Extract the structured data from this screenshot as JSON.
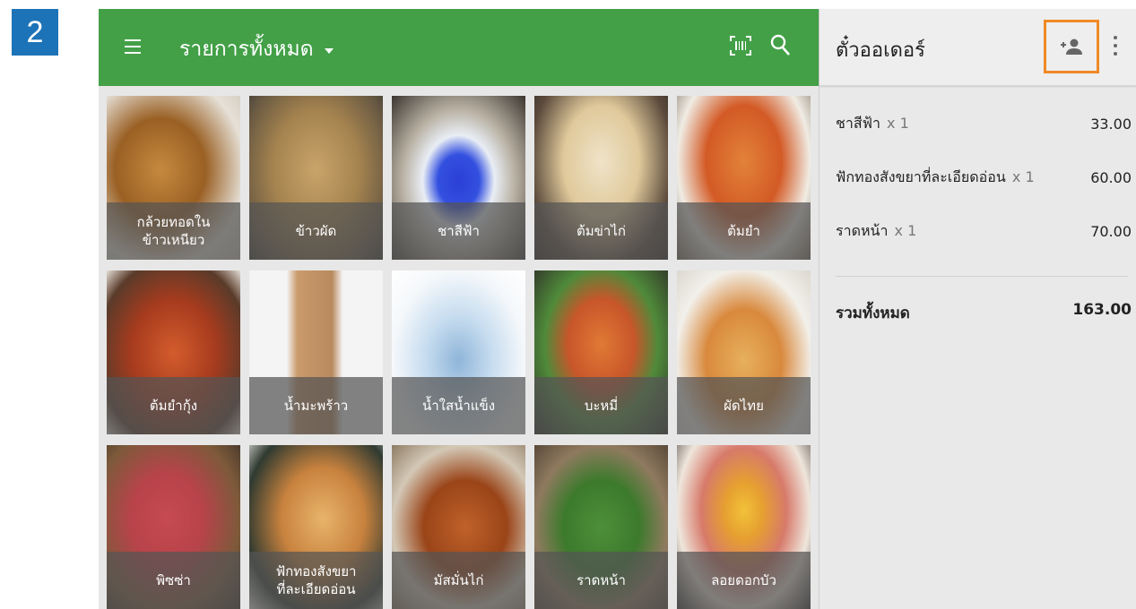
{
  "step": {
    "number": "2",
    "color": "#1d73b8"
  },
  "header": {
    "category_title": "รายการทั้งหมด",
    "accent": "#43a047",
    "icons": [
      "menu-icon",
      "barcode-icon",
      "search-icon"
    ]
  },
  "items": [
    {
      "name": "กล้วยทอดใน\nข้าวเหนียว"
    },
    {
      "name": "ข้าวผัด"
    },
    {
      "name": "ชาสีฟ้า"
    },
    {
      "name": "ต้มข่าไก่"
    },
    {
      "name": "ต้มยำ"
    },
    {
      "name": "ต้มยำกุ้ง"
    },
    {
      "name": "น้ำมะพร้าว"
    },
    {
      "name": "น้ำใสน้ำแข็ง"
    },
    {
      "name": "บะหมี่"
    },
    {
      "name": "ผัดไทย"
    },
    {
      "name": "พิซซ่า"
    },
    {
      "name": "ฟักทองสังขยา\nที่ละเอียดอ่อน"
    },
    {
      "name": "มัสมั่นไก่"
    },
    {
      "name": "ราดหน้า"
    },
    {
      "name": "ลอยดอกบัว"
    }
  ],
  "ticket": {
    "title": "ตั๋วออเดอร์",
    "add_customer_icon": "add-customer-icon",
    "highlight": "#f08a24",
    "lines": [
      {
        "name": "ชาสีฟ้า",
        "qty": "x 1",
        "price": "33.00"
      },
      {
        "name": "ฟักทองสังขยาที่ละเอียดอ่อน",
        "qty": "x 1",
        "price": "60.00"
      },
      {
        "name": "ราดหน้า",
        "qty": "x 1",
        "price": "70.00"
      }
    ],
    "total_label": "รวมทั้งหมด",
    "total_value": "163.00"
  }
}
